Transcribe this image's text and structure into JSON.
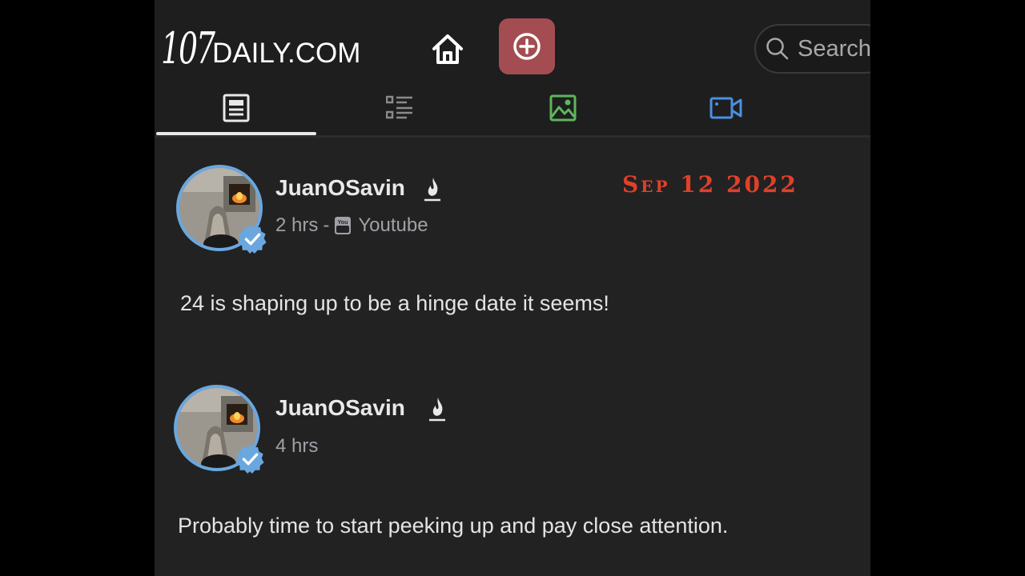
{
  "header": {
    "logo_number": "107",
    "logo_text": "DAILY.COM",
    "search_placeholder": "Search"
  },
  "tabs": [
    {
      "name": "articles",
      "icon": "article-icon",
      "color": "#e8e8e8",
      "active": true
    },
    {
      "name": "list",
      "icon": "list-icon",
      "color": "#8a8a8a",
      "active": false
    },
    {
      "name": "images",
      "icon": "image-icon",
      "color": "#5fb55c",
      "active": false
    },
    {
      "name": "videos",
      "icon": "video-icon",
      "color": "#4a90e2",
      "active": false
    }
  ],
  "overlay": {
    "date": "Sep 12 2022"
  },
  "posts": [
    {
      "username": "JuanOSavin",
      "time": "2 hrs",
      "separator": "-",
      "source": "Youtube",
      "text": "24 is shaping up to be a hinge date it seems!"
    },
    {
      "username": "JuanOSavin",
      "time": "4 hrs",
      "text": "Probably time to start peeking up and pay close attention."
    }
  ],
  "colors": {
    "background": "#222222",
    "topbar": "#1e1e1e",
    "accent_button": "#a34d52",
    "avatar_ring": "#6aa7df",
    "verified_badge": "#6aa7df",
    "date_stamp": "#e0402a"
  }
}
